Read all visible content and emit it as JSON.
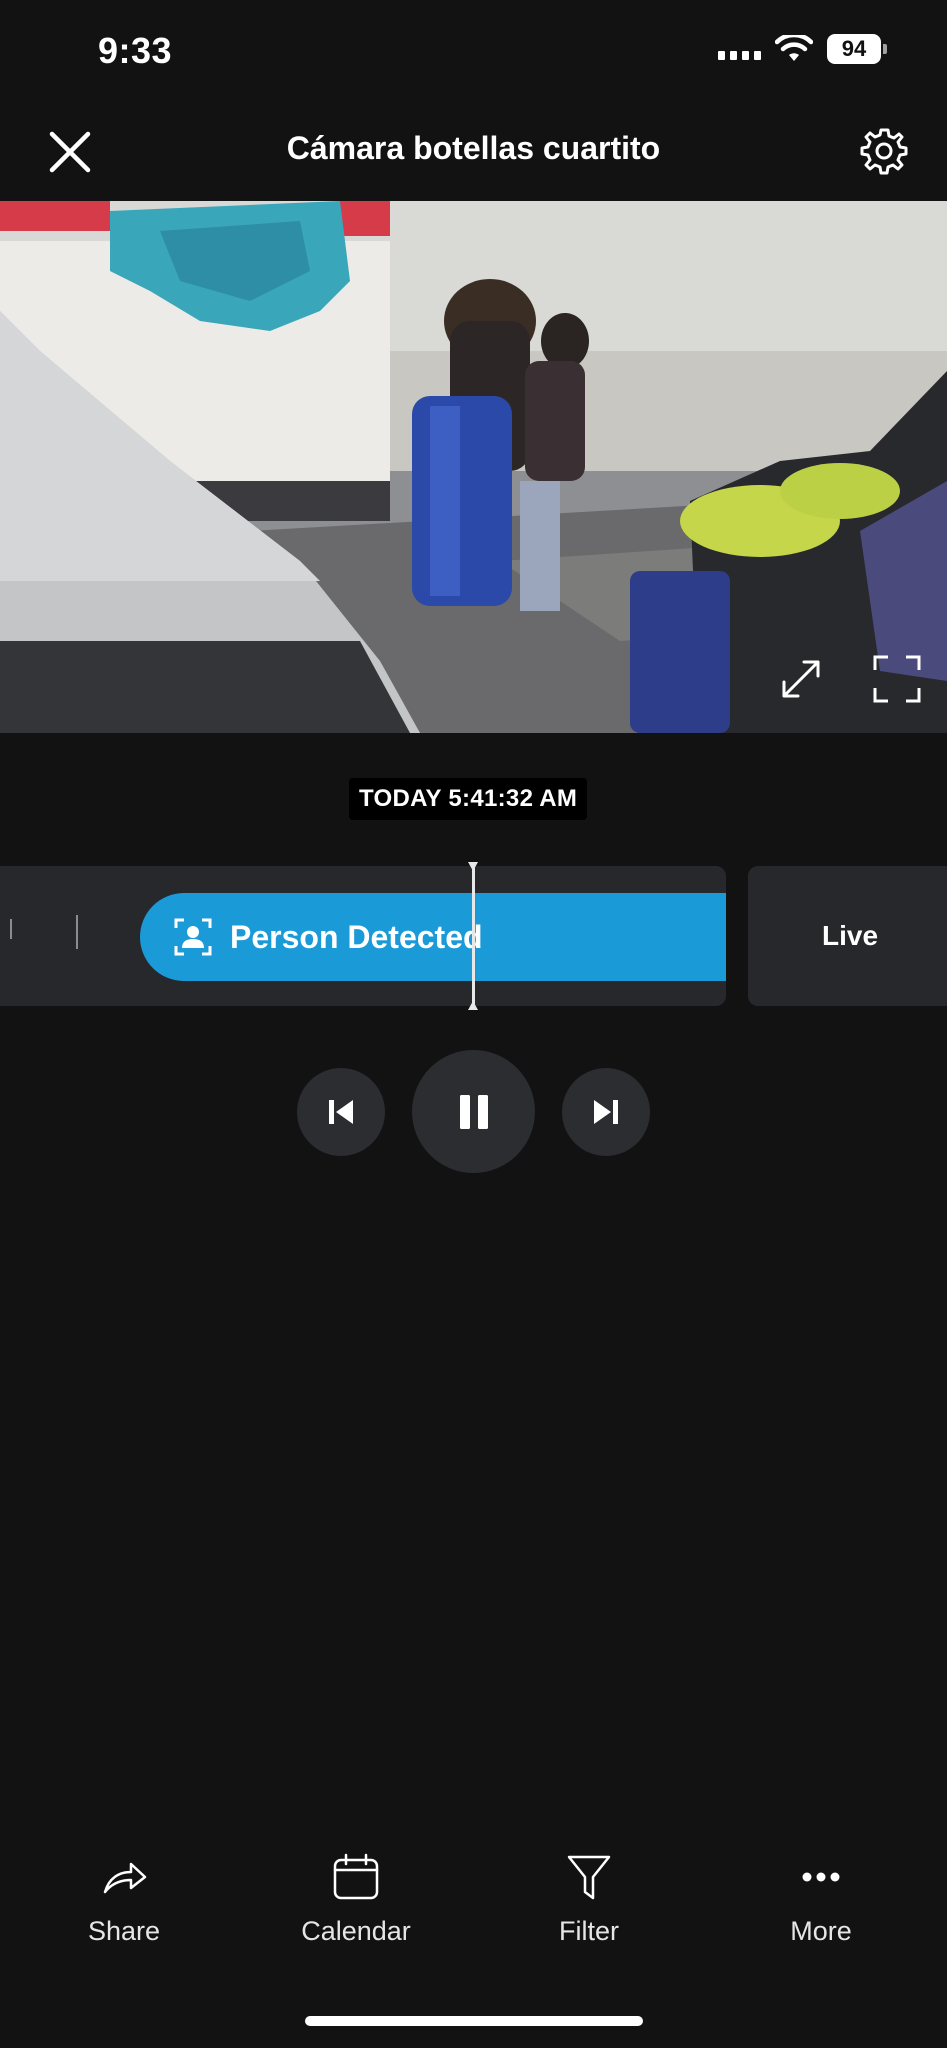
{
  "status_bar": {
    "time": "9:33",
    "battery_level": "94"
  },
  "header": {
    "title": "Cámara botellas cuartito",
    "close_icon": "close-icon",
    "settings_icon": "gear-icon"
  },
  "video": {
    "expand_icon": "expand-arrows-icon",
    "fullscreen_icon": "fullscreen-icon"
  },
  "timeline": {
    "timestamp": "TODAY 5:41:32 AM",
    "event_label": "Person Detected",
    "event_icon": "person-detected-icon",
    "live_label": "Live",
    "event_color": "#1b9ad8"
  },
  "controls": {
    "previous_icon": "skip-previous-icon",
    "pause_icon": "pause-icon",
    "next_icon": "skip-next-icon"
  },
  "bottom_bar": {
    "items": [
      {
        "label": "Share",
        "icon": "share-icon"
      },
      {
        "label": "Calendar",
        "icon": "calendar-icon"
      },
      {
        "label": "Filter",
        "icon": "filter-icon"
      },
      {
        "label": "More",
        "icon": "more-dots-icon"
      }
    ]
  }
}
